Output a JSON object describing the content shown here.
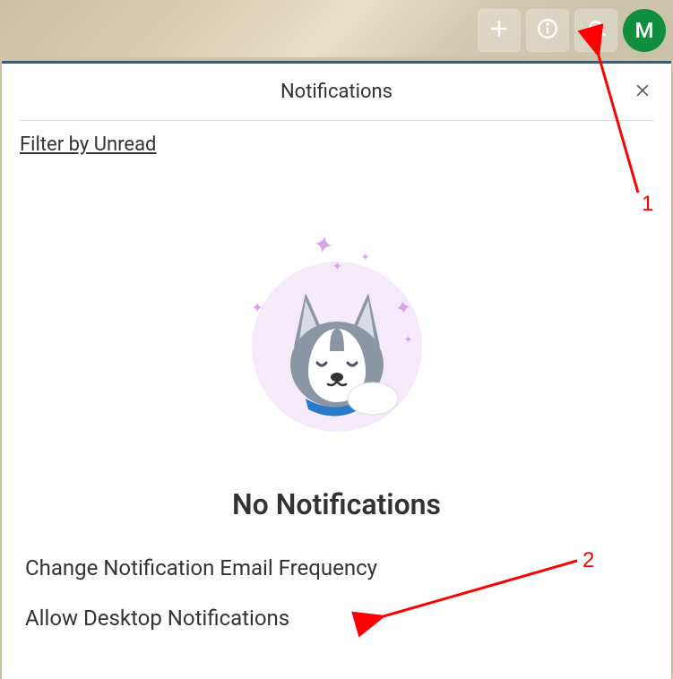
{
  "header": {
    "avatar_initial": "M"
  },
  "panel": {
    "title": "Notifications",
    "filter_label": "Filter by Unread",
    "empty_title": "No Notifications",
    "actions": {
      "change_freq": "Change Notification Email Frequency",
      "allow_desktop": "Allow Desktop Notifications"
    }
  },
  "annotations": {
    "one": "1",
    "two": "2"
  }
}
